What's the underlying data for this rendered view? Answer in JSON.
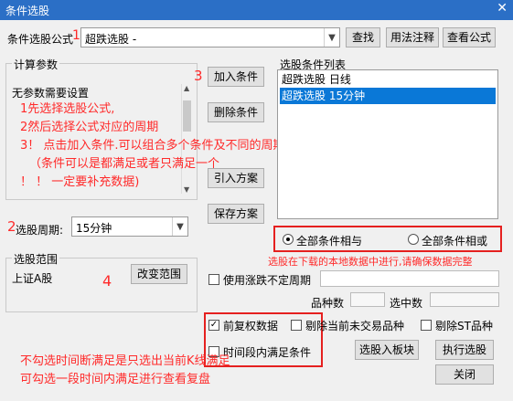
{
  "window": {
    "title": "条件选股",
    "close_glyph": "✕"
  },
  "formula": {
    "label": "条件选股公式",
    "value": "超跌选股  -",
    "marker": "1"
  },
  "buttons": {
    "find": "查找",
    "usage": "用法注释",
    "view_formula": "查看公式",
    "add": "加入条件",
    "delete": "删除条件",
    "import": "引入方案",
    "save": "保存方案",
    "change_range": "改变范围",
    "to_block": "选股入板块",
    "execute": "执行选股",
    "close": "关闭"
  },
  "params": {
    "label": "计算参数",
    "none_text": "无参数需要设置",
    "notes": [
      "1先选择选股公式,",
      "2然后选择公式对应的周期",
      "3！ 点击加入条件.可以组合多个条件及不同的周期",
      "（条件可以是都满足或者只满足一个",
      "！ ！ 一定要补充数据)"
    ]
  },
  "markers": {
    "three": "3",
    "two": "2",
    "four": "4"
  },
  "period": {
    "label": "选股周期:",
    "value": "15分钟"
  },
  "conditions": {
    "label": "选股条件列表",
    "items": [
      {
        "text": "超跌选股  日线",
        "selected": false
      },
      {
        "text": "超跌选股  15分钟",
        "selected": true
      }
    ]
  },
  "logic": {
    "all_and": "全部条件相与",
    "all_or": "全部条件相或",
    "selected": "and"
  },
  "range_note": "选股在下载的本地数据中进行,请确保数据完整",
  "range": {
    "label": "选股范围",
    "value": "上证A股"
  },
  "options": {
    "use_irregular": {
      "label": "使用涨跌不定周期",
      "checked": false
    },
    "stock_count_label": "品种数",
    "selected_count_label": "选中数",
    "restore_rights": {
      "label": "前复权数据",
      "checked": true
    },
    "exclude_non_trading": {
      "label": "剔除当前未交易品种",
      "checked": false
    },
    "exclude_st": {
      "label": "剔除ST品种",
      "checked": false
    },
    "time_range": {
      "label": "时间段内满足条件",
      "checked": false
    }
  },
  "bottom_notes": [
    "不勾选时间断满足是只选出当前K线满足",
    "可勾选一段时间内满足进行查看复盘"
  ],
  "colors": {
    "accent": "#2b6fc6",
    "annotation": "#ff2a2a",
    "selection": "#0a78d7"
  }
}
